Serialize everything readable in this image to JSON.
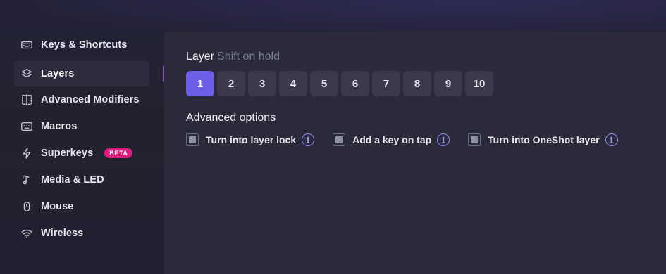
{
  "sidebar": {
    "items": [
      {
        "label": "Keys & Shortcuts",
        "icon": "keyboard-icon"
      },
      {
        "label": "Layers",
        "icon": "layers-icon",
        "active": true
      },
      {
        "label": "Advanced Modifiers",
        "icon": "advanced-modifiers-icon"
      },
      {
        "label": "Macros",
        "icon": "macros-icon"
      },
      {
        "label": "Superkeys",
        "icon": "lightning-icon",
        "badge": "BETA"
      },
      {
        "label": "Media & LED",
        "icon": "media-note-icon"
      },
      {
        "label": "Mouse",
        "icon": "mouse-icon"
      },
      {
        "label": "Wireless",
        "icon": "wifi-icon"
      }
    ]
  },
  "layer": {
    "title": "Layer",
    "subtitle": "Shift on hold",
    "buttons": [
      "1",
      "2",
      "3",
      "4",
      "5",
      "6",
      "7",
      "8",
      "9",
      "10"
    ],
    "selected": "1"
  },
  "advanced": {
    "title": "Advanced options",
    "options": [
      {
        "label": "Turn into layer lock"
      },
      {
        "label": "Add a key on tap"
      },
      {
        "label": "Turn into OneShot layer"
      }
    ],
    "info_glyph": "i"
  },
  "colors": {
    "accent": "#6c5ee6",
    "active_indicator": "#b233e0",
    "beta_badge": "#e3197f",
    "panel": "#2a2a3a"
  }
}
